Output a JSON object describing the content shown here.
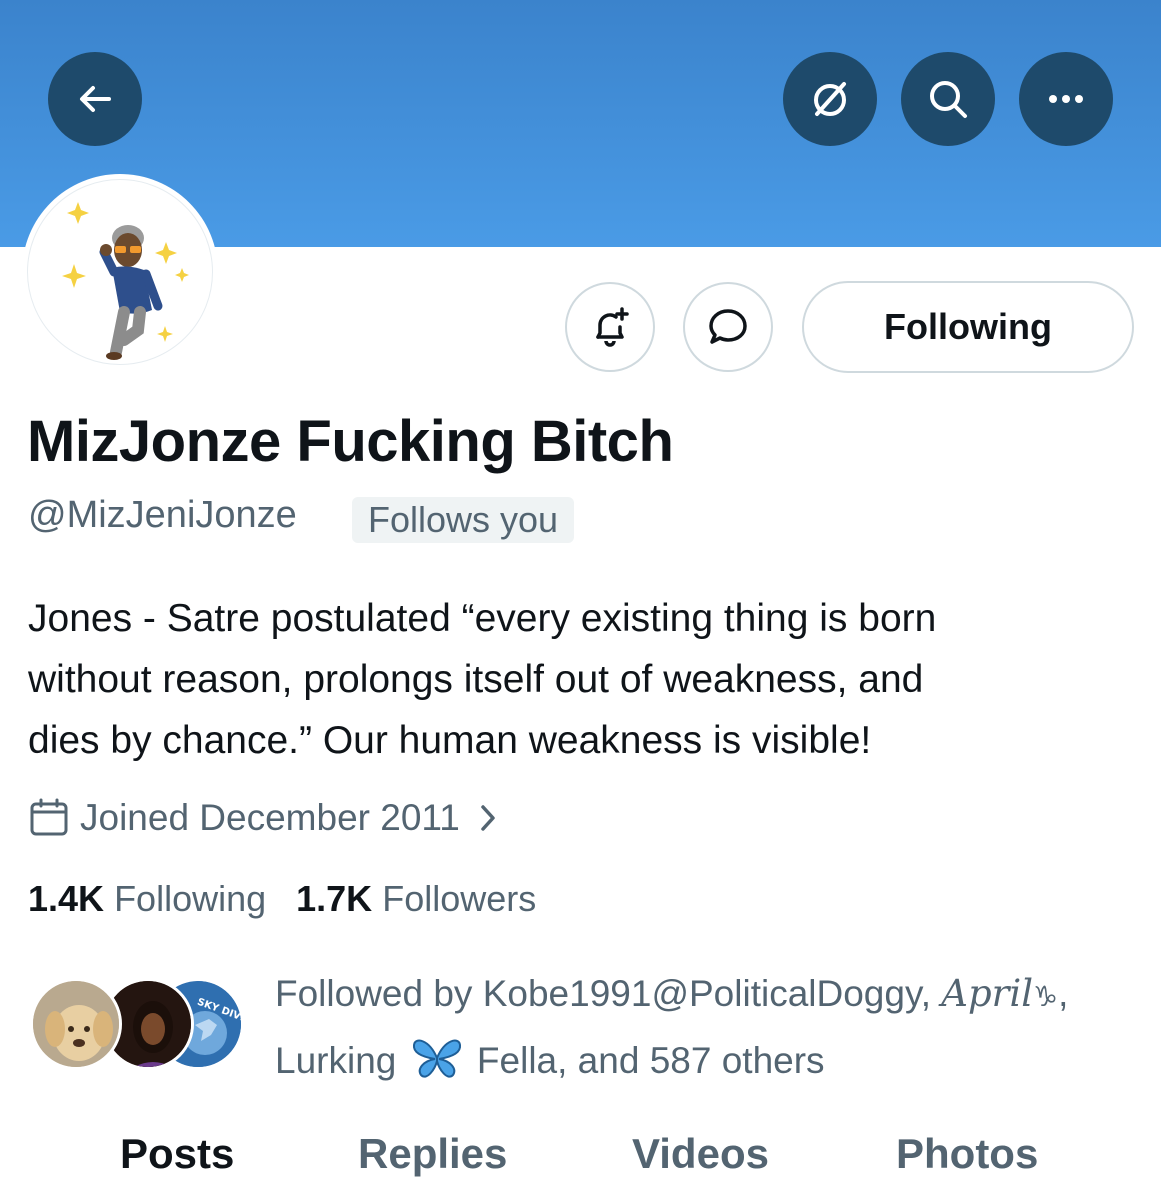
{
  "header": {
    "back_icon": "arrow-left-icon",
    "grok_icon": "slashed-circle-icon",
    "search_icon": "search-icon",
    "more_icon": "more-horizontal-icon",
    "banner_color": "#4a9be6"
  },
  "actions": {
    "notify_icon": "bell-plus-icon",
    "message_icon": "message-bubble-icon",
    "following_label": "Following"
  },
  "profile": {
    "display_name": "MizJonze Fucking Bitch",
    "handle": "@MizJeniJonze",
    "follows_you": "Follows you",
    "bio_lines": [
      "Jones - Satre postulated “every existing thing is born",
      "without reason, prolongs itself out of weakness, and",
      "dies by chance.” Our human weakness is visible!"
    ],
    "joined": "Joined December 2011",
    "following_count": "1.4K",
    "following_label": "Following",
    "followers_count": "1.7K",
    "followers_label": "Followers"
  },
  "followed_by": {
    "prefix": "Followed by ",
    "names_part1": "Kobe1991@PoliticalDoggy, ",
    "name_april": "𝐴𝑝𝑟𝑖𝑙",
    "capricorn": "♑︎",
    "comma": ",",
    "name_lurking": "Lurking",
    "name_fella": "Fella",
    "suffix": ", and 587 others",
    "badge_text": "SKY DIVISION"
  },
  "tabs": [
    "Posts",
    "Replies",
    "Videos",
    "Photos"
  ]
}
